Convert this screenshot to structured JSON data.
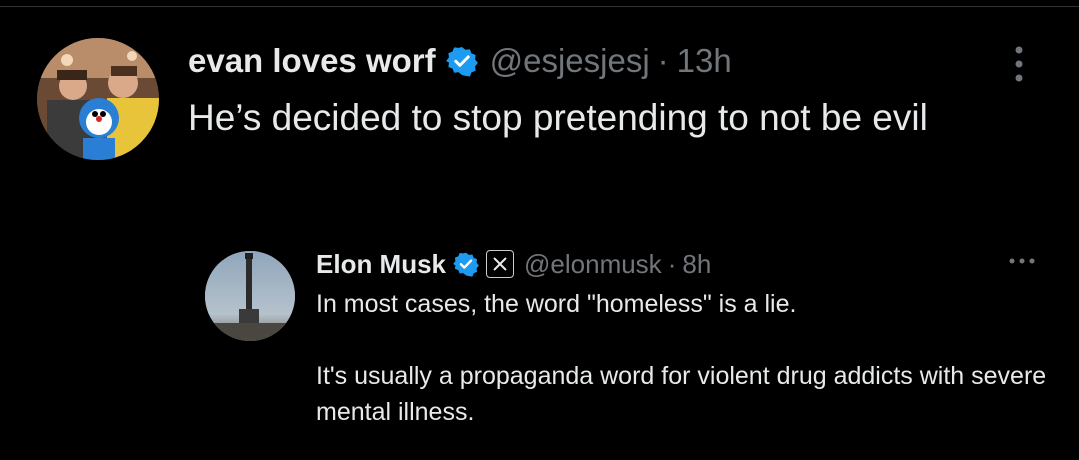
{
  "tweet": {
    "display_name": "evan loves worf",
    "handle": "@esjesjesj",
    "separator": "·",
    "time": "13h",
    "text": "He’s decided to stop pretending to not be evil",
    "icons": {
      "verified": "verified-badge-icon",
      "more": "more-vertical-icon"
    }
  },
  "quoted_tweet": {
    "display_name": "Elon Musk",
    "handle": "@elonmusk",
    "separator": "·",
    "time": "8h",
    "paragraphs": [
      "In most cases, the word \"homeless\" is a lie.",
      "It's usually a propaganda word for violent drug addicts with severe mental illness."
    ],
    "icons": {
      "verified": "verified-badge-icon",
      "affiliate": "x-logo-icon",
      "more": "more-horizontal-icon"
    }
  },
  "colors": {
    "background": "#000000",
    "text": "#e7e9ea",
    "secondary": "#71767b",
    "verified": "#1d9bf0"
  }
}
